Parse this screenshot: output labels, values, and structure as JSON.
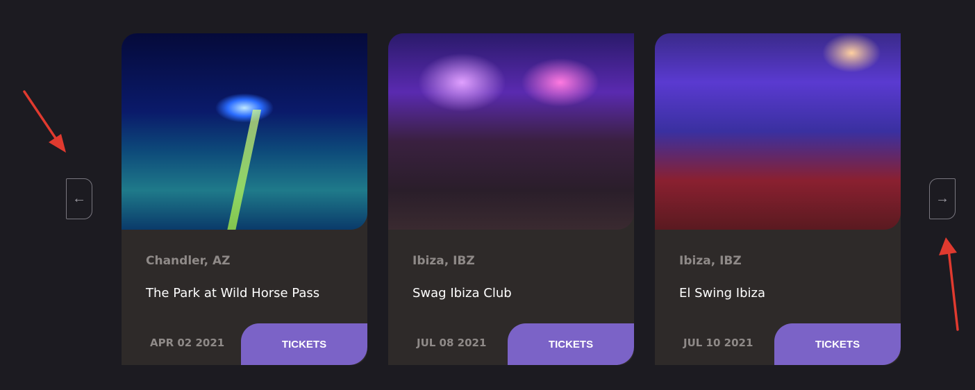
{
  "navigation": {
    "prev_icon": "arrow-left-icon",
    "prev_glyph": "←",
    "next_icon": "arrow-right-icon",
    "next_glyph": "→"
  },
  "colors": {
    "background": "#1c1b21",
    "card": "#2e2a29",
    "accent": "#7b63c7",
    "annotation": "#e03a2f"
  },
  "events": [
    {
      "location": "Chandler, AZ",
      "venue": "The Park at Wild Horse Pass",
      "date": "APR 02 2021",
      "button": "TICKETS"
    },
    {
      "location": "Ibiza, IBZ",
      "venue": "Swag Ibiza Club",
      "date": "JUL 08 2021",
      "button": "TICKETS"
    },
    {
      "location": "Ibiza, IBZ",
      "venue": "El Swing Ibiza",
      "date": "JUL 10 2021",
      "button": "TICKETS"
    }
  ]
}
